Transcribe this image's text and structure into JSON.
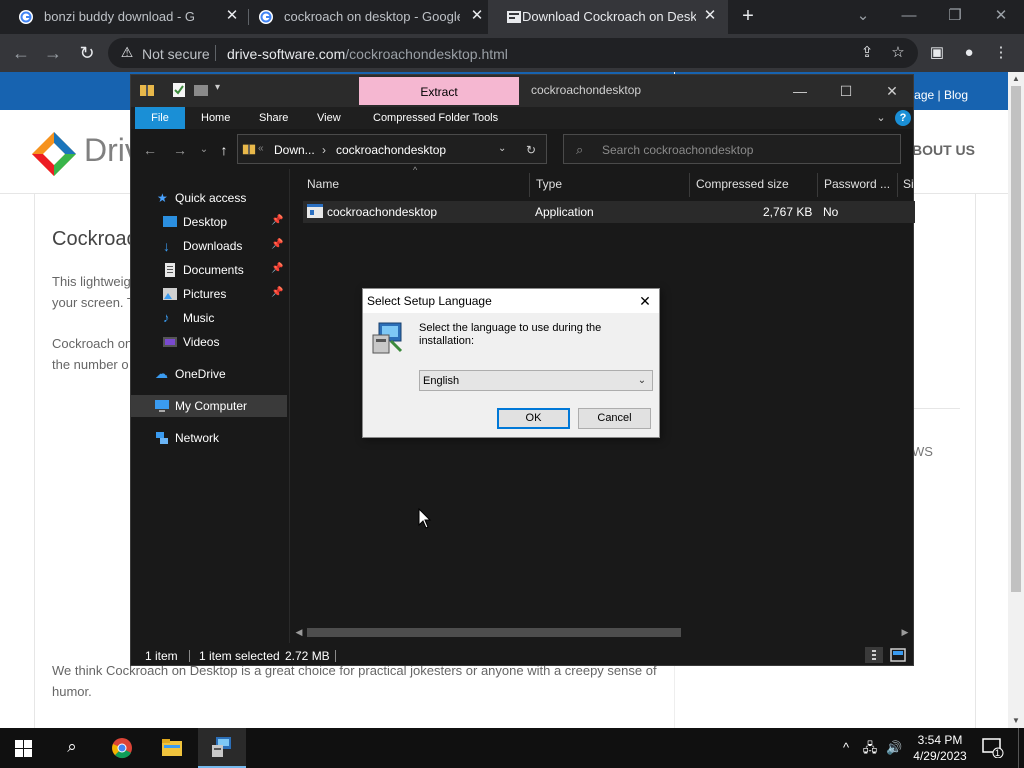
{
  "browser": {
    "tabs": [
      {
        "title": "bonzi buddy download - Google",
        "active": false
      },
      {
        "title": "cockroach on desktop - Google S",
        "active": false
      },
      {
        "title": "Download Cockroach on Desktop",
        "active": true
      }
    ],
    "new_tab_label": "+",
    "security_label": "Not secure",
    "url_host": "drive-software.com",
    "url_path": "/cockroachondesktop.html"
  },
  "webpage": {
    "top_links": "page | Blog",
    "logo_text": "Driv",
    "nav_about": "BOUT US",
    "title": "Cockroac",
    "para1_line1": "This lightweig",
    "para1_line2": "your screen. T",
    "para2_line1": "Cockroach on",
    "para2_line2": "the number o",
    "para3_line1": "We think Cockroach on Desktop is a great choice for practical jokesters or anyone with a creepy sense of",
    "para3_line2": "humor.",
    "side_text": "WS"
  },
  "explorer": {
    "ribbon_context_tab": "Extract",
    "window_title": "cockroachondesktop",
    "ribbon_tabs": [
      "File",
      "Home",
      "Share",
      "View",
      "Compressed Folder Tools"
    ],
    "breadcrumb": [
      "Down...",
      "cockroachondesktop"
    ],
    "search_placeholder": "Search cockroachondesktop",
    "nav": {
      "quick_access": "Quick access",
      "items": [
        {
          "label": "Desktop",
          "pinned": true
        },
        {
          "label": "Downloads",
          "pinned": true
        },
        {
          "label": "Documents",
          "pinned": true
        },
        {
          "label": "Pictures",
          "pinned": true
        },
        {
          "label": "Music",
          "pinned": false
        },
        {
          "label": "Videos",
          "pinned": false
        }
      ],
      "onedrive": "OneDrive",
      "my_computer": "My Computer",
      "network": "Network"
    },
    "columns": [
      "Name",
      "Type",
      "Compressed size",
      "Password ...",
      "Si"
    ],
    "files": [
      {
        "name": "cockroachondesktop",
        "type": "Application",
        "size": "2,767 KB",
        "password": "No"
      }
    ],
    "status": {
      "count": "1 item",
      "selected": "1 item selected",
      "selected_size": "2.72 MB"
    }
  },
  "dialog": {
    "title": "Select Setup Language",
    "message": "Select the language to use during the installation:",
    "selected_language": "English",
    "ok_label": "OK",
    "cancel_label": "Cancel"
  },
  "taskbar": {
    "time": "3:54 PM",
    "date": "4/29/2023",
    "notification_count": "1"
  },
  "colors": {
    "extract_tab": "#f5b7d1",
    "file_tab": "#1a8fd6",
    "web_topbar": "#1763b0",
    "default_button_border": "#0078d7"
  }
}
